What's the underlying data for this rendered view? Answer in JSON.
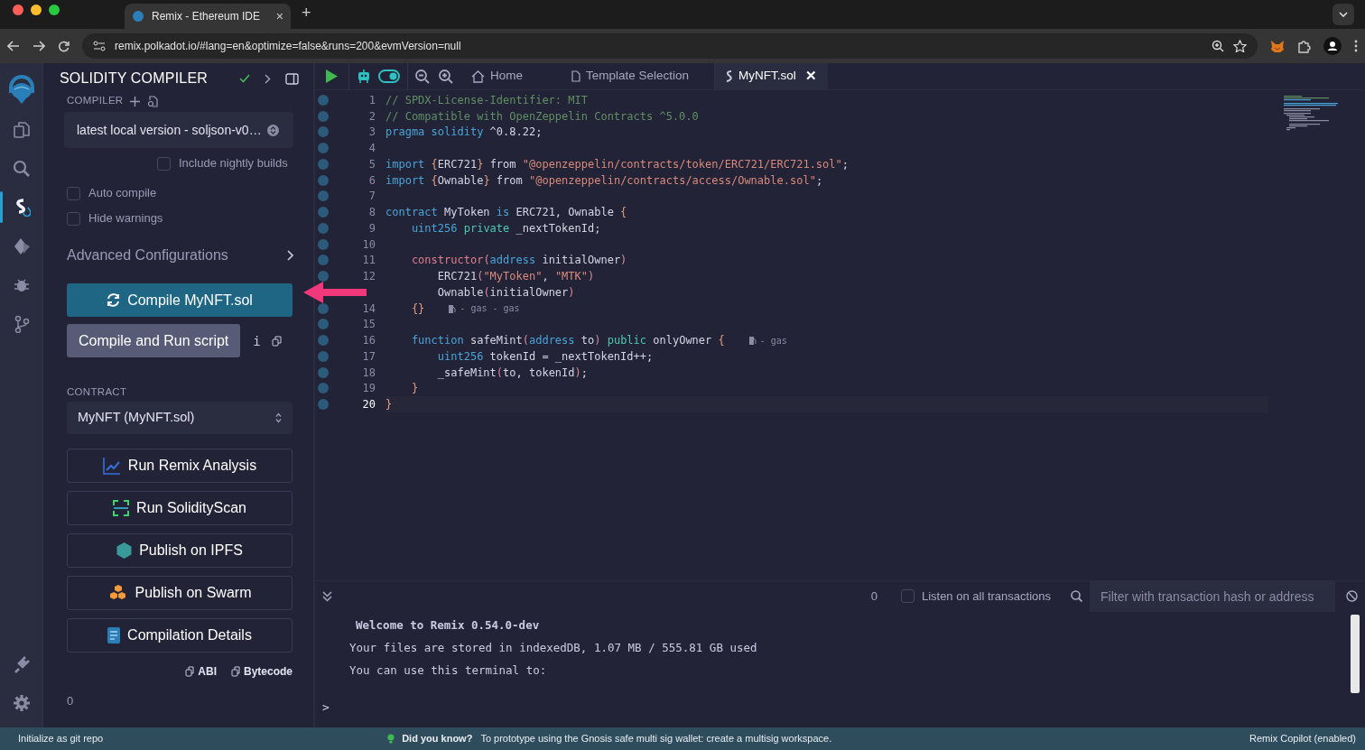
{
  "browser": {
    "tab": {
      "title": "Remix - Ethereum IDE",
      "close": "×"
    },
    "new_tab": "+",
    "address": "remix.polkadot.io/#lang=en&optimize=false&runs=200&evmVersion=null"
  },
  "rail": [
    {
      "kind": "files",
      "selected": false
    },
    {
      "kind": "search",
      "selected": false
    },
    {
      "kind": "compiler",
      "selected": true
    },
    {
      "kind": "deploy",
      "selected": false
    },
    {
      "kind": "debug",
      "selected": false
    },
    {
      "kind": "git",
      "selected": false
    }
  ],
  "rail_bottom": [
    {
      "kind": "plugin"
    },
    {
      "kind": "settings"
    }
  ],
  "panel": {
    "title": "SOLIDITY COMPILER",
    "compiler_label": "COMPILER",
    "compiler_select": "latest local version - soljson-v0…",
    "checks": [
      {
        "label": "Include nightly builds",
        "checked": false
      },
      {
        "label": "Auto compile",
        "checked": false
      },
      {
        "label": "Hide warnings",
        "checked": false
      }
    ],
    "advanced": "Advanced Configurations",
    "compile_button": "Compile MyNFT.sol",
    "run_script_button": "Compile and Run script",
    "info": "i",
    "contract_label": "CONTRACT",
    "contract_select": "MyNFT (MyNFT.sol)",
    "actions": [
      {
        "kind": "analysis",
        "label": "Run Remix Analysis"
      },
      {
        "kind": "scan",
        "label": "Run SolidityScan"
      },
      {
        "kind": "ipfs",
        "label": "Publish on IPFS"
      },
      {
        "kind": "swarm",
        "label": "Publish on Swarm"
      },
      {
        "kind": "details",
        "label": "Compilation Details"
      }
    ],
    "copy_links": [
      "ABI",
      "Bytecode"
    ],
    "count": "0"
  },
  "editor": {
    "tabs": [
      {
        "kind": "home",
        "label": "Home",
        "selected": false
      },
      {
        "kind": "file",
        "label": "Template Selection",
        "selected": false
      },
      {
        "kind": "solidity",
        "label": "MyNFT.sol",
        "selected": true,
        "close": "✕"
      }
    ],
    "lines": [
      {
        "number": "1",
        "active": false,
        "tokens": [
          {
            "kind": "comment",
            "text": "// SPDX-License-Identifier: MIT"
          }
        ]
      },
      {
        "number": "2",
        "active": false,
        "tokens": [
          {
            "kind": "comment",
            "text": "// Compatible with OpenZeppelin Contracts ^5.0.0"
          }
        ]
      },
      {
        "number": "3",
        "active": false,
        "tokens": [
          {
            "kind": "keyword",
            "text": "pragma solidity"
          },
          {
            "kind": "plain",
            "text": " ^0.8.22;"
          }
        ]
      },
      {
        "number": "4",
        "active": false
      },
      {
        "number": "5",
        "active": false,
        "tokens": [
          {
            "kind": "keyword",
            "text": "import "
          },
          {
            "kind": "brace",
            "text": "{"
          },
          {
            "kind": "plain",
            "text": "ERC721"
          },
          {
            "kind": "brace",
            "text": "}"
          },
          {
            "kind": "plain",
            "text": " from "
          },
          {
            "kind": "string",
            "text": "\"@openzeppelin/contracts/token/ERC721/ERC721.sol\""
          },
          {
            "kind": "plain",
            "text": ";"
          }
        ]
      },
      {
        "number": "6",
        "active": false,
        "tokens": [
          {
            "kind": "keyword",
            "text": "import "
          },
          {
            "kind": "brace",
            "text": "{"
          },
          {
            "kind": "plain",
            "text": "Ownable"
          },
          {
            "kind": "brace",
            "text": "}"
          },
          {
            "kind": "plain",
            "text": " from "
          },
          {
            "kind": "string",
            "text": "\"@openzeppelin/contracts/access/Ownable.sol\""
          },
          {
            "kind": "plain",
            "text": ";"
          }
        ]
      },
      {
        "number": "7",
        "active": false
      },
      {
        "number": "8",
        "active": false,
        "tokens": [
          {
            "kind": "keyword",
            "text": "contract"
          },
          {
            "kind": "plain",
            "text": " MyToken "
          },
          {
            "kind": "keyword",
            "text": "is"
          },
          {
            "kind": "plain",
            "text": " ERC721, Ownable "
          },
          {
            "kind": "brace",
            "text": "{"
          }
        ]
      },
      {
        "number": "9",
        "active": false,
        "tokens": [
          {
            "kind": "keyword",
            "text": "    uint256 "
          },
          {
            "kind": "modifier",
            "text": "private"
          },
          {
            "kind": "plain",
            "text": " _nextTokenId;"
          }
        ]
      },
      {
        "number": "10",
        "active": false
      },
      {
        "number": "11",
        "active": false,
        "tokens": [
          {
            "kind": "special",
            "text": "    constructor"
          },
          {
            "kind": "paren",
            "text": "("
          },
          {
            "kind": "keyword",
            "text": "address"
          },
          {
            "kind": "plain",
            "text": " initialOwner"
          },
          {
            "kind": "paren",
            "text": ")"
          }
        ]
      },
      {
        "number": "12",
        "active": false,
        "tokens": [
          {
            "kind": "plain",
            "text": "        ERC721"
          },
          {
            "kind": "paren",
            "text": "("
          },
          {
            "kind": "string",
            "text": "\"MyToken\""
          },
          {
            "kind": "plain",
            "text": ", "
          },
          {
            "kind": "string",
            "text": "\"MTK\""
          },
          {
            "kind": "paren",
            "text": ")"
          }
        ]
      },
      {
        "active": false,
        "tokens": [
          {
            "kind": "plain",
            "text": "        Ownable"
          },
          {
            "kind": "paren",
            "text": "("
          },
          {
            "kind": "plain",
            "text": "initialOwner"
          },
          {
            "kind": "paren",
            "text": ")"
          }
        ]
      },
      {
        "number": "14",
        "active": false,
        "tokens": [
          {
            "kind": "brace",
            "text": "    {}"
          }
        ],
        "hint": "- gas - gas"
      },
      {
        "number": "15",
        "active": false
      },
      {
        "number": "16",
        "active": false,
        "tokens": [
          {
            "kind": "keyword",
            "text": "    function"
          },
          {
            "kind": "plain",
            "text": " safeMint"
          },
          {
            "kind": "paren",
            "text": "("
          },
          {
            "kind": "keyword",
            "text": "address"
          },
          {
            "kind": "plain",
            "text": " to"
          },
          {
            "kind": "paren",
            "text": ") "
          },
          {
            "kind": "modifier",
            "text": "public"
          },
          {
            "kind": "plain",
            "text": " onlyOwner "
          },
          {
            "kind": "brace",
            "text": "{"
          }
        ],
        "hint": "- gas"
      },
      {
        "number": "17",
        "active": false,
        "tokens": [
          {
            "kind": "keyword",
            "text": "        uint256"
          },
          {
            "kind": "plain",
            "text": " tokenId = _nextTokenId++;"
          }
        ]
      },
      {
        "number": "18",
        "active": false,
        "tokens": [
          {
            "kind": "plain",
            "text": "        _safeMint"
          },
          {
            "kind": "paren",
            "text": "("
          },
          {
            "kind": "plain",
            "text": "to, tokenId"
          },
          {
            "kind": "paren",
            "text": ")"
          },
          {
            "kind": "plain",
            "text": ";"
          }
        ]
      },
      {
        "number": "19",
        "active": false,
        "tokens": [
          {
            "kind": "brace",
            "text": "    }"
          }
        ]
      },
      {
        "number": "20",
        "active": true,
        "tokens": [
          {
            "kind": "brace",
            "text": "}"
          }
        ]
      }
    ]
  },
  "terminal": {
    "count": "0",
    "listen": {
      "label": "Listen on all transactions",
      "checked": false
    },
    "filter": {
      "placeholder": "Filter with transaction hash or address"
    },
    "lines": [
      {
        "kind": "heading",
        "text": "Welcome to Remix 0.54.0-dev"
      },
      {
        "kind": "text",
        "text": "Your files are stored in indexedDB, 1.07 MB / 555.81 GB used"
      },
      {
        "kind": "text",
        "text": "You can use this terminal to:"
      }
    ],
    "prompt": ">"
  },
  "status_bar": {
    "left": "Initialize as git repo",
    "tip_title": "Did you know?",
    "tip": "To prototype using the Gnosis safe multi sig wallet: create a multisig workspace.",
    "right": "Remix Copilot (enabled)"
  }
}
